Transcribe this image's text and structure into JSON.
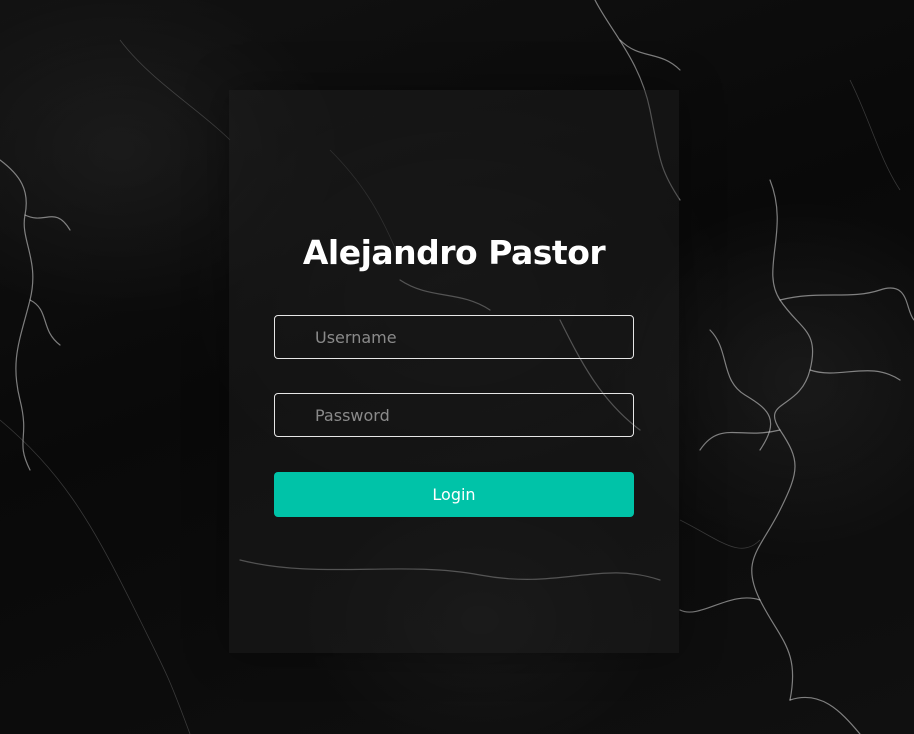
{
  "login": {
    "title": "Alejandro Pastor",
    "username_placeholder": "Username",
    "password_placeholder": "Password",
    "submit_label": "Login"
  },
  "colors": {
    "accent": "#00c3a8",
    "background": "#0b0b0b",
    "text": "#ffffff"
  }
}
